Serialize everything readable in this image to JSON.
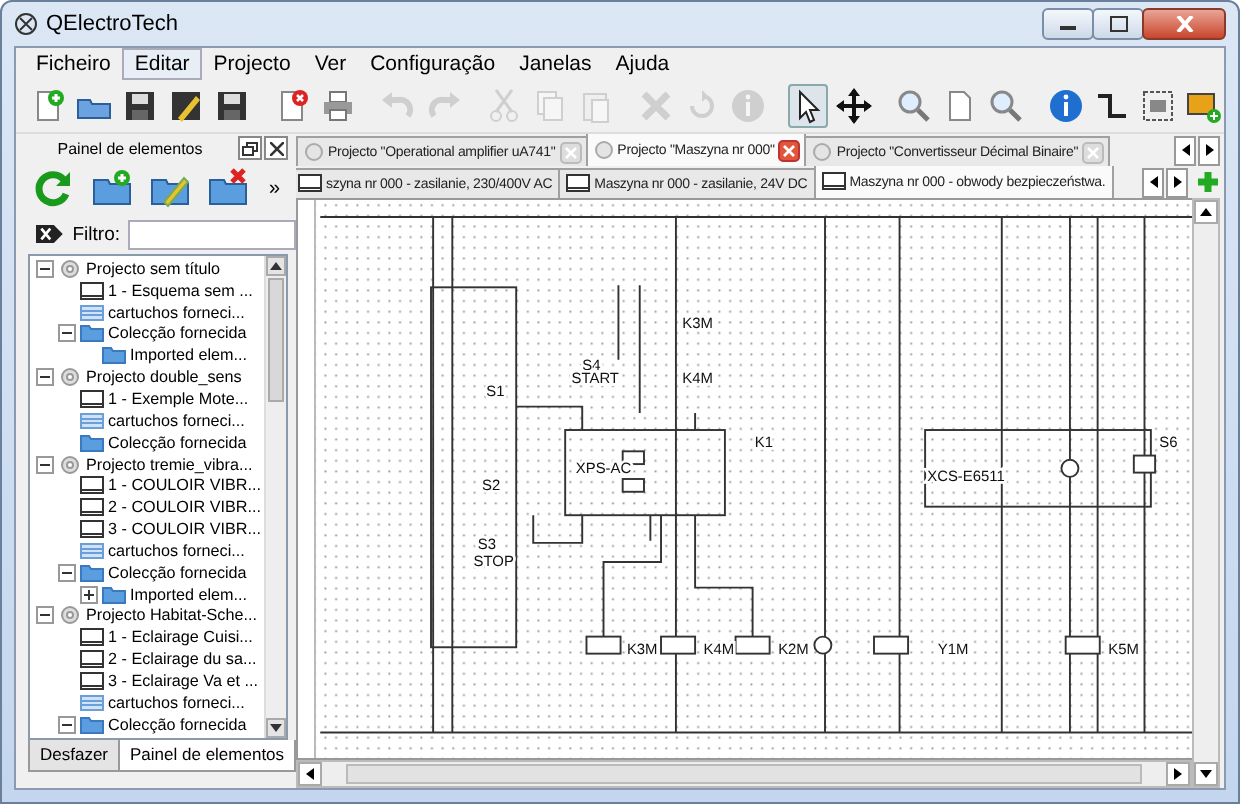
{
  "window": {
    "title": "QElectroTech"
  },
  "menu": [
    {
      "label": "Ficheiro",
      "selected": false
    },
    {
      "label": "Editar",
      "selected": true
    },
    {
      "label": "Projecto",
      "selected": false
    },
    {
      "label": "Ver",
      "selected": false
    },
    {
      "label": "Configuração",
      "selected": false
    },
    {
      "label": "Janelas",
      "selected": false
    },
    {
      "label": "Ajuda",
      "selected": false
    }
  ],
  "toolbar": [
    {
      "kind": "new",
      "disabled": false,
      "selected": false
    },
    {
      "kind": "open",
      "disabled": false,
      "selected": false
    },
    {
      "kind": "save",
      "disabled": false,
      "selected": false
    },
    {
      "kind": "save-as",
      "disabled": false,
      "selected": false
    },
    {
      "kind": "save",
      "disabled": false,
      "selected": false
    },
    {
      "kind": "sep"
    },
    {
      "kind": "close-doc",
      "disabled": false,
      "selected": false
    },
    {
      "kind": "print",
      "disabled": false,
      "selected": false
    },
    {
      "kind": "sep"
    },
    {
      "kind": "undo",
      "disabled": true,
      "selected": false
    },
    {
      "kind": "redo",
      "disabled": true,
      "selected": false
    },
    {
      "kind": "sep"
    },
    {
      "kind": "cut",
      "disabled": true,
      "selected": false
    },
    {
      "kind": "copy",
      "disabled": true,
      "selected": false
    },
    {
      "kind": "paste",
      "disabled": true,
      "selected": false
    },
    {
      "kind": "sep"
    },
    {
      "kind": "delete",
      "disabled": true,
      "selected": false
    },
    {
      "kind": "rotate",
      "disabled": true,
      "selected": false
    },
    {
      "kind": "info",
      "disabled": true,
      "selected": false
    },
    {
      "kind": "sep"
    },
    {
      "kind": "pointer",
      "disabled": false,
      "selected": true
    },
    {
      "kind": "move",
      "disabled": false,
      "selected": false
    },
    {
      "kind": "sep"
    },
    {
      "kind": "zoom",
      "disabled": false,
      "selected": false
    },
    {
      "kind": "page",
      "disabled": false,
      "selected": false
    },
    {
      "kind": "zoom",
      "disabled": false,
      "selected": false
    },
    {
      "kind": "sep"
    },
    {
      "kind": "info",
      "disabled": false,
      "selected": false
    },
    {
      "kind": "conductor",
      "disabled": false,
      "selected": false
    },
    {
      "kind": "frame",
      "disabled": false,
      "selected": false
    },
    {
      "kind": "image",
      "disabled": false,
      "selected": false
    }
  ],
  "elements_panel": {
    "title": "Painel de elementos",
    "toolbar": [
      {
        "kind": "reload"
      },
      {
        "kind": "new-folder"
      },
      {
        "kind": "edit-folder"
      },
      {
        "kind": "delete-folder"
      }
    ],
    "overflow": "»",
    "filter": {
      "label": "Filtro:"
    },
    "tree": [
      {
        "label": "Projecto sem título",
        "kind": "project",
        "expanded": true,
        "children": [
          {
            "label": "1 - Esquema sem ...",
            "kind": "diagram"
          },
          {
            "label": "cartuchos forneci...",
            "kind": "titleblock"
          },
          {
            "label": "Colecção fornecida",
            "kind": "collection",
            "expanded": true,
            "children": [
              {
                "label": "Imported elem...",
                "kind": "collection"
              }
            ]
          }
        ]
      },
      {
        "label": "Projecto double_sens",
        "kind": "project",
        "expanded": true,
        "children": [
          {
            "label": "1 - Exemple Mote...",
            "kind": "diagram"
          },
          {
            "label": "cartuchos forneci...",
            "kind": "titleblock"
          },
          {
            "label": "Colecção fornecida",
            "kind": "collection"
          }
        ]
      },
      {
        "label": "Projecto tremie_vibra...",
        "kind": "project",
        "expanded": true,
        "children": [
          {
            "label": "1 - COULOIR VIBR...",
            "kind": "diagram"
          },
          {
            "label": "2 - COULOIR VIBR...",
            "kind": "diagram"
          },
          {
            "label": "3 - COULOIR VIBR...",
            "kind": "diagram"
          },
          {
            "label": "cartuchos forneci...",
            "kind": "titleblock"
          },
          {
            "label": "Colecção fornecida",
            "kind": "collection",
            "expanded": true,
            "children": [
              {
                "label": "Imported elem...",
                "kind": "collection",
                "expanded": false
              }
            ]
          }
        ]
      },
      {
        "label": "Projecto Habitat-Sche...",
        "kind": "project",
        "expanded": true,
        "children": [
          {
            "label": "1 - Eclairage Cuisi...",
            "kind": "diagram"
          },
          {
            "label": "2 - Eclairage du sa...",
            "kind": "diagram"
          },
          {
            "label": "3 - Eclairage Va et ...",
            "kind": "diagram"
          },
          {
            "label": "cartuchos forneci...",
            "kind": "titleblock"
          },
          {
            "label": "Colecção fornecida",
            "kind": "collection",
            "expanded": true
          }
        ]
      }
    ]
  },
  "bottom_tabs": [
    {
      "label": "Desfazer",
      "selected": false
    },
    {
      "label": "Painel de elementos",
      "selected": true
    }
  ],
  "project_tabs": [
    {
      "label": "Projecto \"Operational amplifier uA741\"",
      "selected": false
    },
    {
      "label": "Projecto \"Maszyna nr 000\"",
      "selected": true
    },
    {
      "label": "Projecto \"Convertisseur Décimal Binaire\"",
      "selected": false
    }
  ],
  "sheet_tabs": [
    {
      "label": "szyna nr 000 - zasilanie, 230/400V AC",
      "selected": false
    },
    {
      "label": "Maszyna nr 000 - zasilanie, 24V DC",
      "selected": false
    },
    {
      "label": "Maszyna nr 000 - obwody bezpieczeństwa.",
      "selected": true
    }
  ],
  "schematic": {
    "labels": [
      "S1",
      "S2",
      "S3",
      "STOP",
      "S4",
      "START",
      "K3M",
      "K4M",
      "XPS-AC",
      "K1",
      "XCS-E6511",
      "S6",
      "K3M",
      "K4M",
      "K2M",
      "Y1M",
      "K5M"
    ]
  }
}
